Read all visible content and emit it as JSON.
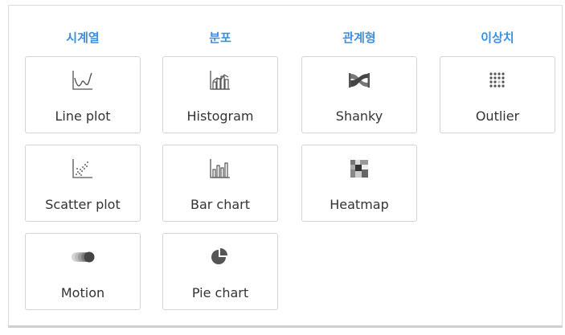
{
  "categories": [
    {
      "title": "시계열",
      "items": [
        {
          "label": "Line plot",
          "icon": "line-plot-icon"
        },
        {
          "label": "Scatter plot",
          "icon": "scatter-plot-icon"
        },
        {
          "label": "Motion",
          "icon": "motion-icon"
        }
      ]
    },
    {
      "title": "분포",
      "items": [
        {
          "label": "Histogram",
          "icon": "histogram-icon"
        },
        {
          "label": "Bar chart",
          "icon": "bar-chart-icon"
        },
        {
          "label": "Pie chart",
          "icon": "pie-chart-icon"
        }
      ]
    },
    {
      "title": "관계형",
      "items": [
        {
          "label": "Shanky",
          "icon": "sankey-icon"
        },
        {
          "label": "Heatmap",
          "icon": "heatmap-icon"
        }
      ]
    },
    {
      "title": "이상치",
      "items": [
        {
          "label": "Outlier",
          "icon": "outlier-icon"
        }
      ]
    }
  ],
  "colors": {
    "accent": "#3b8fe0",
    "icon": "#555555"
  }
}
